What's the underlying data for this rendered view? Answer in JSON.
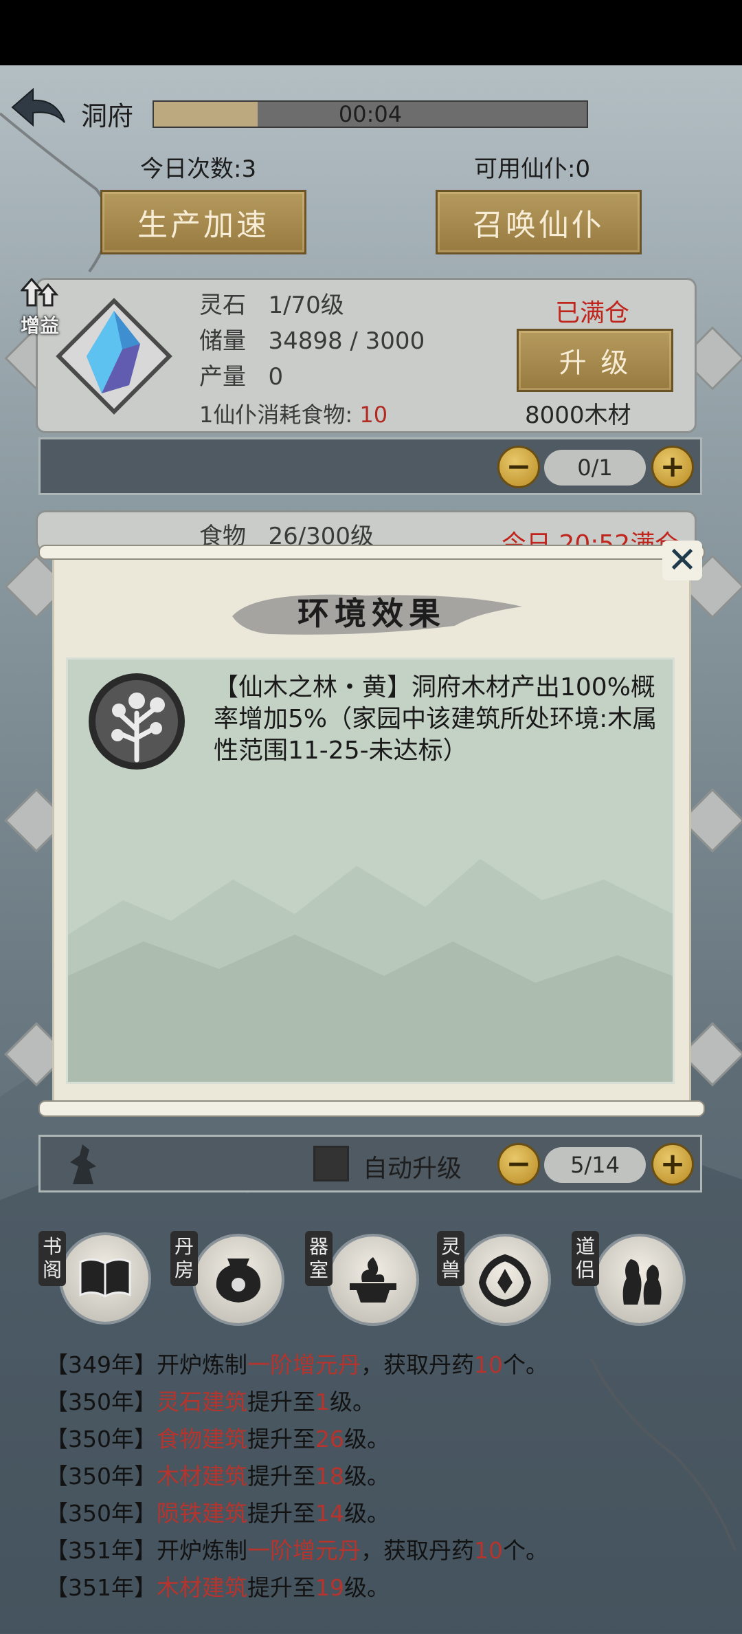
{
  "header": {
    "title": "洞府",
    "timer": "00:04",
    "timer_progress": 0.24
  },
  "stats": {
    "today_count": "今日次数:3",
    "available_servants": "可用仙仆:0"
  },
  "buttons": {
    "speedup": "生产加速",
    "summon": "召唤仙仆"
  },
  "building": {
    "boost": "增益",
    "name": "灵石",
    "level": "1/70级",
    "stock_label": "储量",
    "stock_value": "34898 / 3000",
    "output_label": "产量",
    "output_value": "0",
    "consume_label": "1仙仆消耗食物:",
    "consume_value": "10",
    "status": "已满仓",
    "upgrade": "升 级",
    "cost": "8000木材",
    "servant_count": "0/1"
  },
  "building2": {
    "name": "食物",
    "level": "26/300级",
    "status": "今日 20:52满仓"
  },
  "dialog": {
    "title": "环境效果",
    "close": "✕",
    "effect_text": "【仙木之林・黄】洞府木材产出100%概率增加5%（家园中该建筑所处环境:木属性范围11-25-未达标）"
  },
  "auto_upgrade": {
    "label": "自动升级",
    "count": "5/14"
  },
  "minus": "−",
  "plus": "+",
  "nav": [
    {
      "tag": "书阁",
      "icon": "book-icon"
    },
    {
      "tag": "丹房",
      "icon": "furnace-icon"
    },
    {
      "tag": "器室",
      "icon": "forge-icon"
    },
    {
      "tag": "灵兽",
      "icon": "phoenix-icon"
    },
    {
      "tag": "道侣",
      "icon": "companion-icon"
    }
  ],
  "log": [
    {
      "year": "【349年】",
      "a": "开炉炼制",
      "b": "一阶增元丹",
      "c": "，获取丹药",
      "d": "10",
      "e": "个。"
    },
    {
      "year": "【350年】",
      "a": "",
      "b": "灵石建筑",
      "c": "提升至",
      "d": "1",
      "e": "级。"
    },
    {
      "year": "【350年】",
      "a": "",
      "b": "食物建筑",
      "c": "提升至",
      "d": "26",
      "e": "级。"
    },
    {
      "year": "【350年】",
      "a": "",
      "b": "木材建筑",
      "c": "提升至",
      "d": "18",
      "e": "级。"
    },
    {
      "year": "【350年】",
      "a": "",
      "b": "陨铁建筑",
      "c": "提升至",
      "d": "14",
      "e": "级。"
    },
    {
      "year": "【351年】",
      "a": "开炉炼制",
      "b": "一阶增元丹",
      "c": "，获取丹药",
      "d": "10",
      "e": "个。"
    },
    {
      "year": "【351年】",
      "a": "",
      "b": "木材建筑",
      "c": "提升至",
      "d": "19",
      "e": "级。"
    }
  ]
}
